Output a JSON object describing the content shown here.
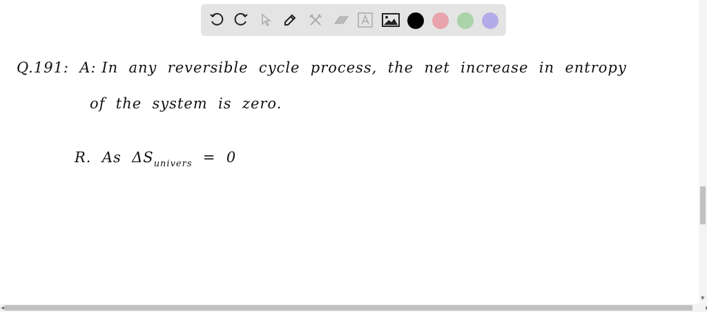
{
  "toolbar": {
    "tools": [
      "undo-icon",
      "redo-icon",
      "select-icon",
      "pen-icon",
      "tools-icon",
      "eraser-icon",
      "text-icon",
      "image-icon"
    ],
    "colors": [
      "#000000",
      "#e8a3ad",
      "#a9d4a9",
      "#b3abe8"
    ]
  },
  "canvas": {
    "line1": "Q.191:  A: In  any  reversible  cycle  process,  the  net  increase  in  entropy",
    "line2": "of  the  system  is  zero.",
    "line3_prefix": "R.  As  ΔS",
    "line3_sub": "univers",
    "line3_suffix": "  =  0"
  }
}
